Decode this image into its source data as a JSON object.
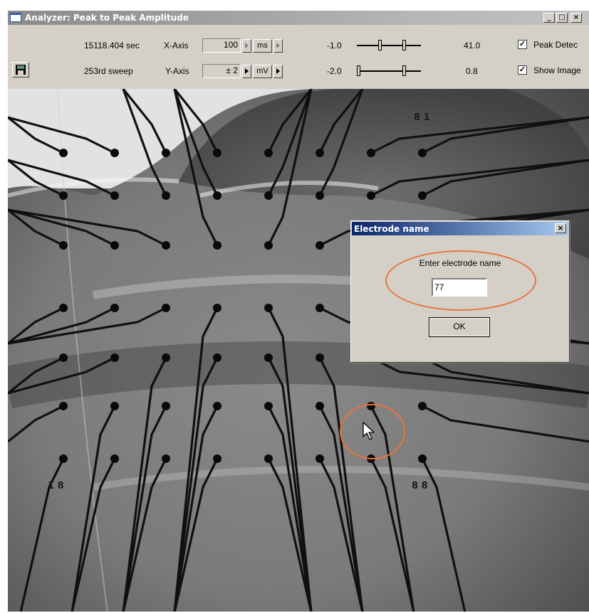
{
  "window": {
    "title": "Analyzer: Peak to Peak Amplitude",
    "minimize_glyph": "_",
    "maximize_glyph": "□",
    "close_glyph": "×"
  },
  "toolbar": {
    "time_text": "15118.404 sec",
    "sweep_text": "253rd sweep",
    "x_axis_label": "X-Axis",
    "x_axis_value": "100",
    "x_axis_unit": "ms",
    "y_axis_label": "Y-Axis",
    "y_axis_value": "± 2",
    "y_axis_unit": "mV",
    "slider1_min": "-1.0",
    "slider1_max": "41.0",
    "slider2_min": "-2.0",
    "slider2_max": "0.8",
    "peak_detect_label": "Peak Detec",
    "show_image_label": "Show Image",
    "peak_detect_checked": true,
    "show_image_checked": true
  },
  "image_labels": {
    "label_81": "8 1",
    "label_18": "1 8",
    "label_88": "8 8"
  },
  "dialog": {
    "title": "Electrode name",
    "close_glyph": "×",
    "prompt": "Enter electrode name",
    "input_value": "77",
    "ok_label": "OK"
  },
  "colors": {
    "highlight": "#e8743b",
    "dialog_title_start": "#0a246a",
    "dialog_title_end": "#a6caf0"
  },
  "icons": {
    "save": "floppy-disk-icon",
    "cursor": "mouse-pointer-icon"
  }
}
